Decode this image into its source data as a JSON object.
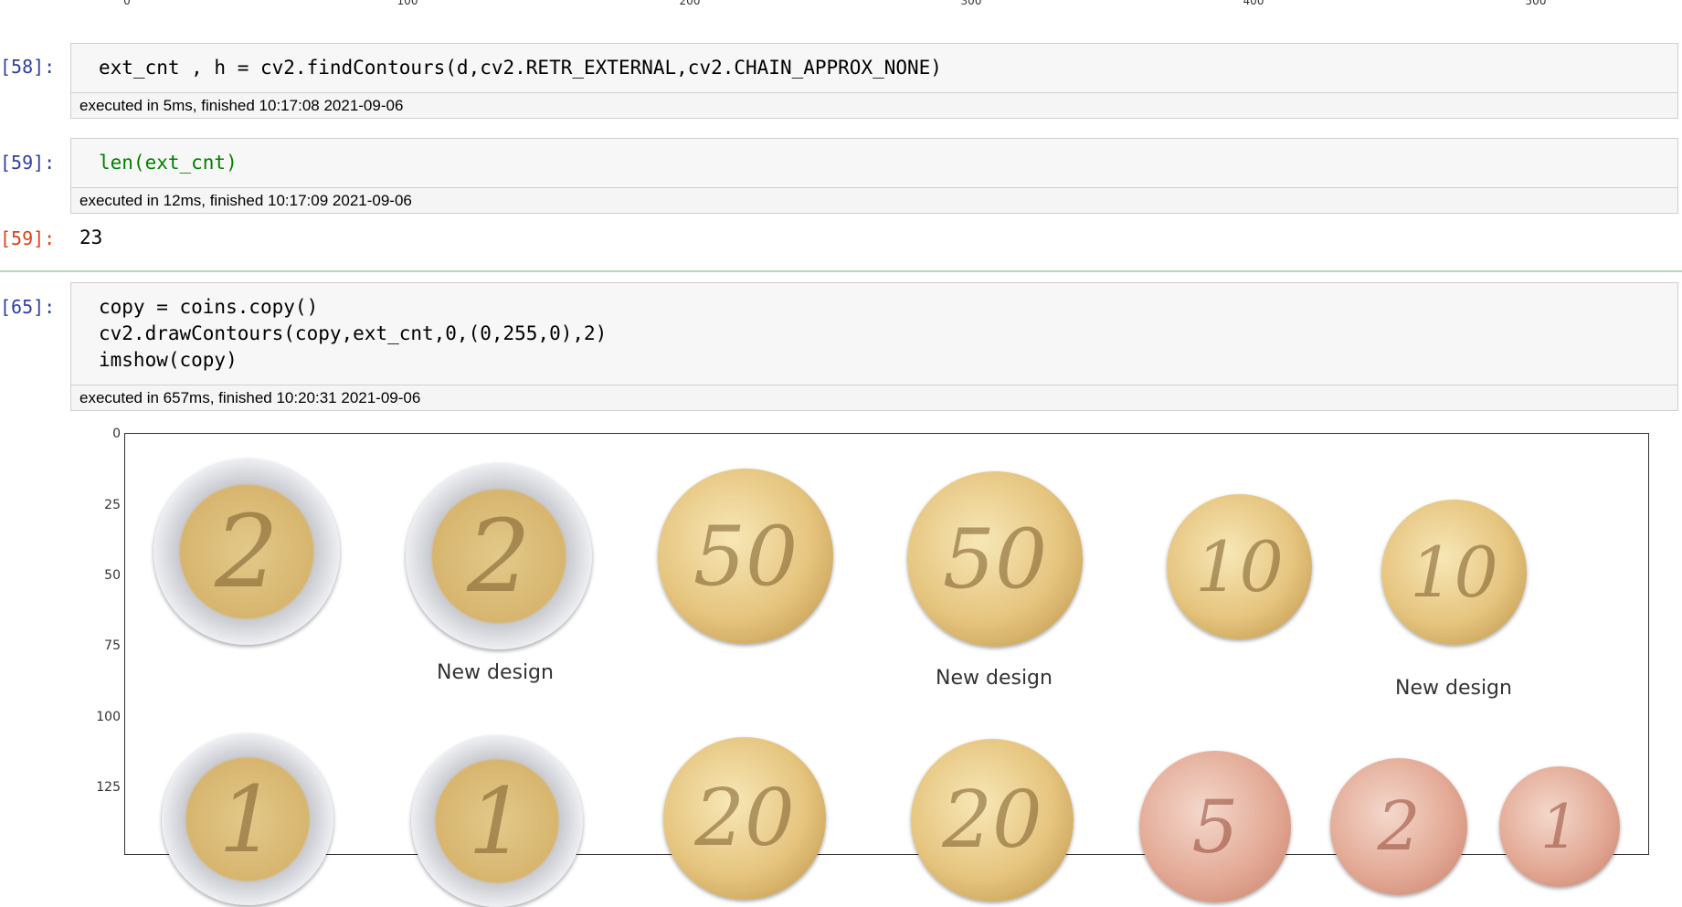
{
  "top_axis": {
    "ticks": [
      "0",
      "100",
      "200",
      "300",
      "400",
      "500"
    ]
  },
  "cells": [
    {
      "prompt": "[58]:",
      "code": "ext_cnt , h = cv2.findContours(d,cv2.RETR_EXTERNAL,cv2.CHAIN_APPROX_NONE)",
      "exec": "executed in 5ms, finished 10:17:08 2021-09-06"
    },
    {
      "prompt": "[59]:",
      "code": "len(ext_cnt)",
      "exec": "executed in 12ms, finished 10:17:09 2021-09-06",
      "out_prompt": "[59]:",
      "output": "23"
    },
    {
      "prompt": "[65]:",
      "code_lines": [
        "copy = coins.copy()",
        "cv2.drawContours(copy,ext_cnt,0,(0,255,0),2)",
        "imshow(copy)"
      ],
      "exec": "executed in 657ms, finished 10:20:31 2021-09-06"
    }
  ],
  "plot": {
    "y_ticks": [
      "0",
      "25",
      "50",
      "75",
      "100",
      "125"
    ],
    "coins_row1": [
      {
        "label": "2",
        "type": "bi"
      },
      {
        "label": "2",
        "type": "bi",
        "caption": "New design"
      },
      {
        "label": "50",
        "type": "gold"
      },
      {
        "label": "50",
        "type": "gold",
        "caption": "New design"
      },
      {
        "label": "10",
        "type": "gold"
      },
      {
        "label": "10",
        "type": "gold",
        "caption": "New design"
      }
    ],
    "coins_row2": [
      {
        "label": "1",
        "type": "bi"
      },
      {
        "label": "1",
        "type": "bi"
      },
      {
        "label": "20",
        "type": "gold"
      },
      {
        "label": "20",
        "type": "gold"
      },
      {
        "label": "5",
        "type": "copper"
      },
      {
        "label": "2",
        "type": "copper"
      },
      {
        "label": "1",
        "type": "copper"
      }
    ]
  }
}
